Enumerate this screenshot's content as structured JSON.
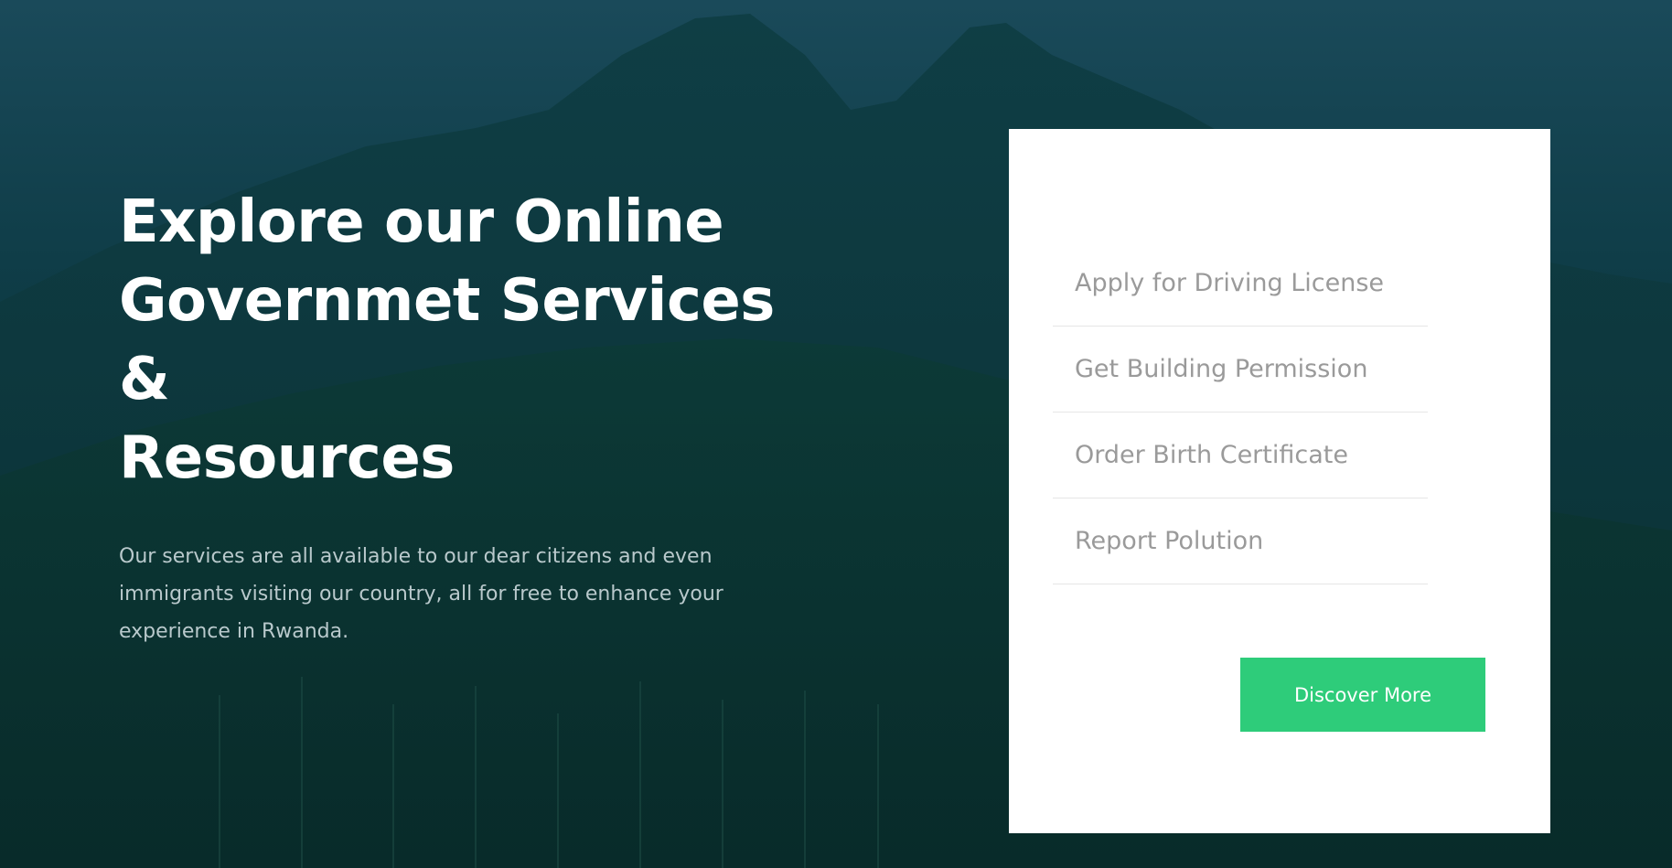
{
  "hero": {
    "title_line1": "Explore our Online",
    "title_line2": "Governmet Services &",
    "title_line3": "Resources",
    "description": "Our services are all available to our dear citizens and even immigrants visiting our country, all for free to enhance your experience in Rwanda."
  },
  "services": {
    "items": [
      {
        "label": "Apply for Driving License"
      },
      {
        "label": "Get Building Permission"
      },
      {
        "label": "Order Birth Certificate"
      },
      {
        "label": "Report Polution"
      }
    ],
    "button_label": "Discover More"
  },
  "colors": {
    "background": "#0d3a40",
    "accent": "#2ecc7a",
    "card": "#ffffff",
    "service_text": "#9a9a9a"
  }
}
